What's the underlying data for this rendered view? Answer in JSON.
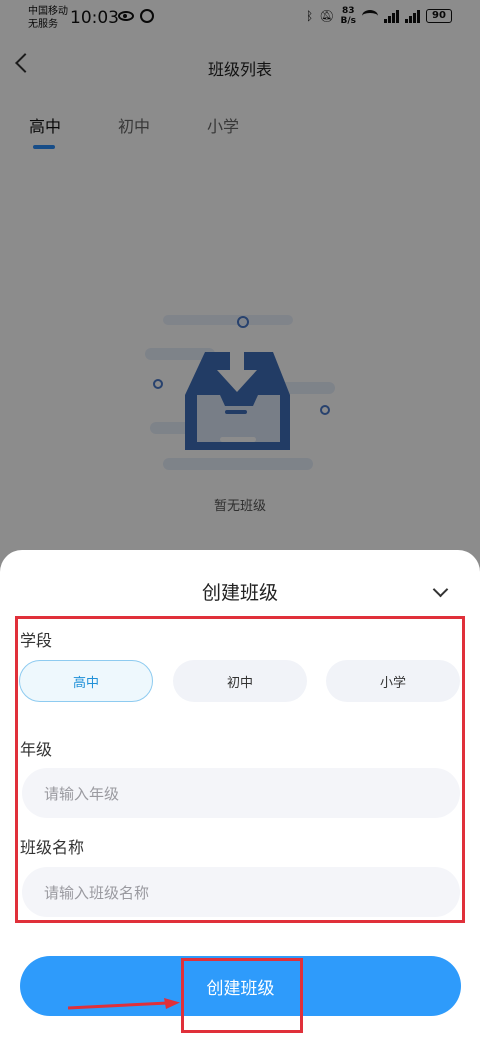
{
  "status_bar": {
    "carrier_line1": "中国移动",
    "carrier_line2": "无服务",
    "time": "10:03",
    "net_speed_value": "83",
    "net_speed_unit": "B/s",
    "battery": "90",
    "icons": [
      "eye-icon",
      "alarm-icon",
      "bluetooth-icon",
      "mute-icon",
      "wifi-icon",
      "signal-icon",
      "battery-icon"
    ]
  },
  "header": {
    "title": "班级列表"
  },
  "tabs": [
    {
      "label": "高中",
      "active": true
    },
    {
      "label": "初中",
      "active": false
    },
    {
      "label": "小学",
      "active": false
    }
  ],
  "empty_state": {
    "message": "暂无班级"
  },
  "sheet": {
    "title": "创建班级",
    "stage_label": "学段",
    "stage_options": [
      {
        "label": "高中",
        "selected": true
      },
      {
        "label": "初中",
        "selected": false
      },
      {
        "label": "小学",
        "selected": false
      }
    ],
    "grade_label": "年级",
    "grade_placeholder": "请输入年级",
    "class_name_label": "班级名称",
    "class_name_placeholder": "请输入班级名称",
    "submit_label": "创建班级"
  },
  "colors": {
    "accent": "#2e9bfb",
    "highlight": "#e0303a",
    "selected_text": "#1f90d8"
  }
}
